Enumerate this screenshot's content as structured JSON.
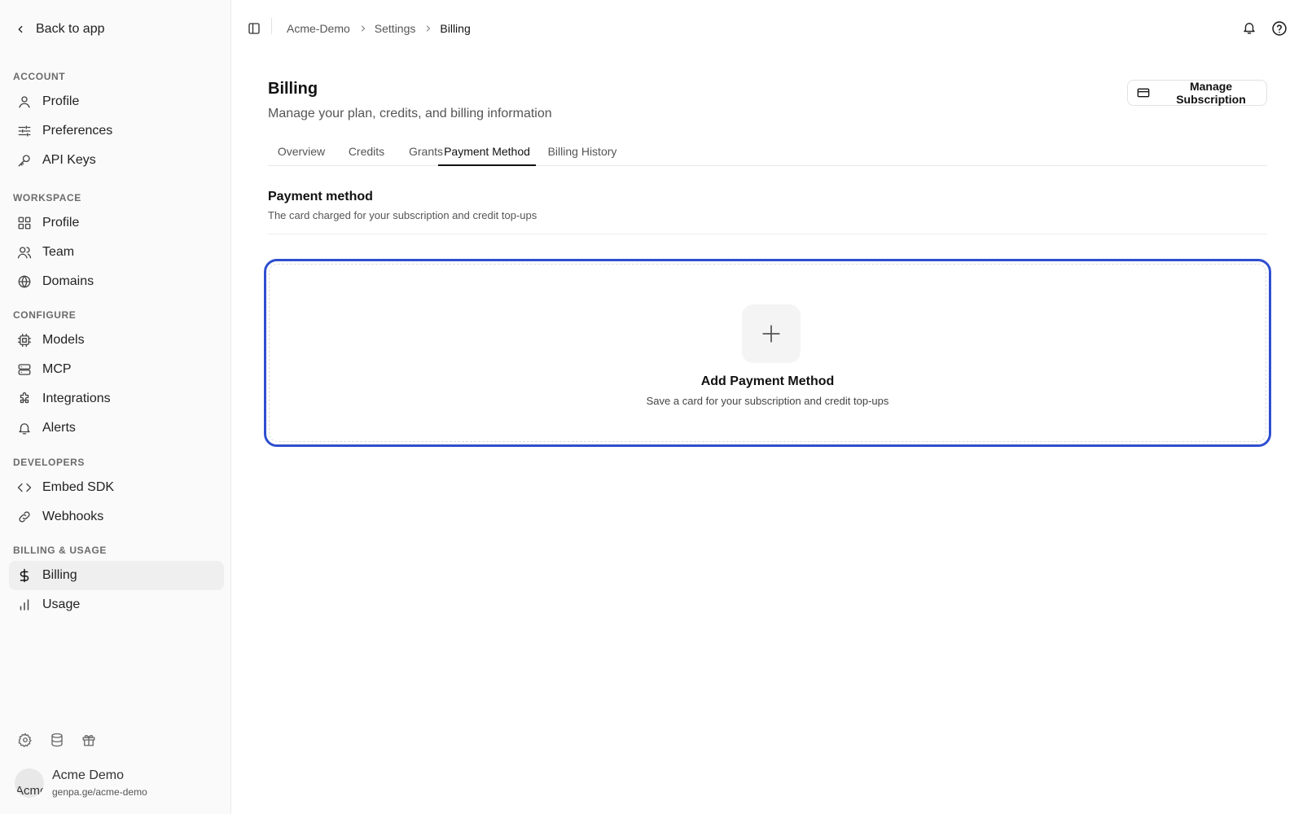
{
  "sidebar": {
    "back_label": "Back to app",
    "sections": {
      "account": "ACCOUNT",
      "workspace": "WORKSPACE",
      "configure": "CONFIGURE",
      "developers": "DEVELOPERS",
      "billing_usage": "BILLING & USAGE"
    },
    "items": {
      "account_profile": "Profile",
      "preferences": "Preferences",
      "api_keys": "API Keys",
      "workspace_profile": "Profile",
      "team": "Team",
      "domains": "Domains",
      "models": "Models",
      "mcp": "MCP",
      "integrations": "Integrations",
      "alerts": "Alerts",
      "embed_sdk": "Embed SDK",
      "webhooks": "Webhooks",
      "billing": "Billing",
      "usage": "Usage"
    },
    "active_item": "billing",
    "user": {
      "name": "Acme Demo",
      "handle": "genpa.ge/acme-demo",
      "avatar_alt": "Acme"
    }
  },
  "topbar": {
    "breadcrumb": [
      "Acme-Demo",
      "Settings",
      "Billing"
    ]
  },
  "page": {
    "title": "Billing",
    "subtitle": "Manage your plan, credits, and billing information",
    "manage_button": "Manage Subscription",
    "tabs": [
      "Overview",
      "Credits",
      "Grants",
      "Payment Method",
      "Billing History"
    ],
    "active_tab": "Payment Method"
  },
  "payment_section": {
    "title": "Payment method",
    "subtitle": "The card charged for your subscription and credit top-ups"
  },
  "add_card": {
    "title": "Add Payment Method",
    "subtitle": "Save a card for your subscription and credit top-ups"
  },
  "colors": {
    "focus_ring": "#2f4fcf",
    "sidebar_bg": "#fafafa",
    "active_bg": "#efefef"
  }
}
